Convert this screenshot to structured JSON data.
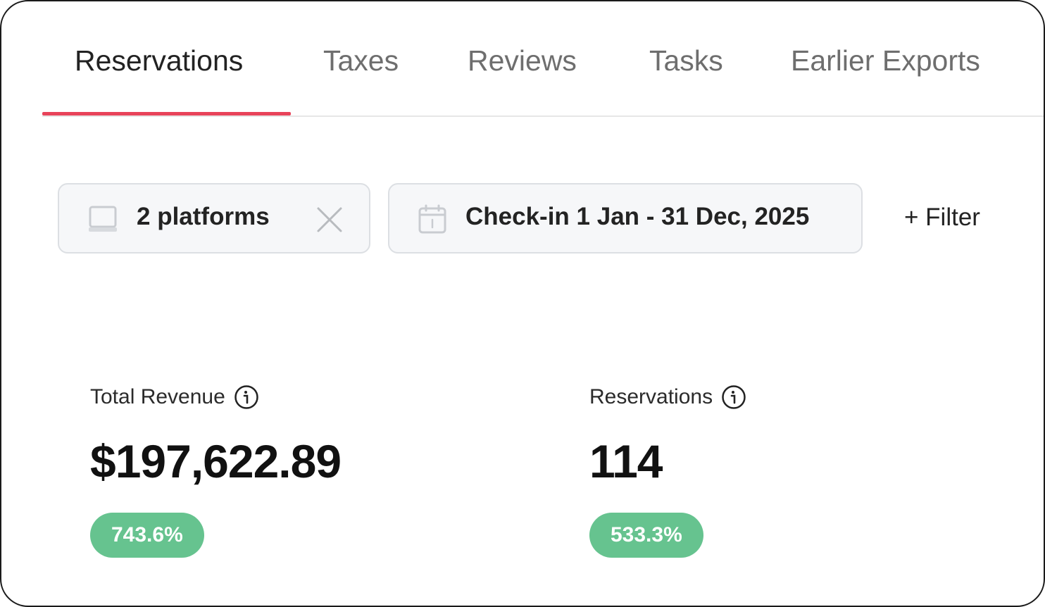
{
  "tabs": [
    {
      "label": "Reservations",
      "active": true
    },
    {
      "label": "Taxes",
      "active": false
    },
    {
      "label": "Reviews",
      "active": false
    },
    {
      "label": "Tasks",
      "active": false
    },
    {
      "label": "Earlier Exports",
      "active": false
    }
  ],
  "filters": {
    "platforms": {
      "label": "2 platforms",
      "icon": "laptop-icon",
      "clear_icon": "close-icon"
    },
    "dates": {
      "label": "Check-in 1 Jan - 31 Dec, 2025",
      "icon": "calendar-icon"
    },
    "add_filter_label": "+ Filter"
  },
  "stats": {
    "revenue": {
      "label": "Total Revenue",
      "value": "$197,622.89",
      "change": "743.6%",
      "icon": "info-icon"
    },
    "reservations": {
      "label": "Reservations",
      "value": "114",
      "change": "533.3%",
      "icon": "info-icon"
    }
  },
  "colors": {
    "accent": "#e8435a",
    "badge": "#66c38f"
  }
}
